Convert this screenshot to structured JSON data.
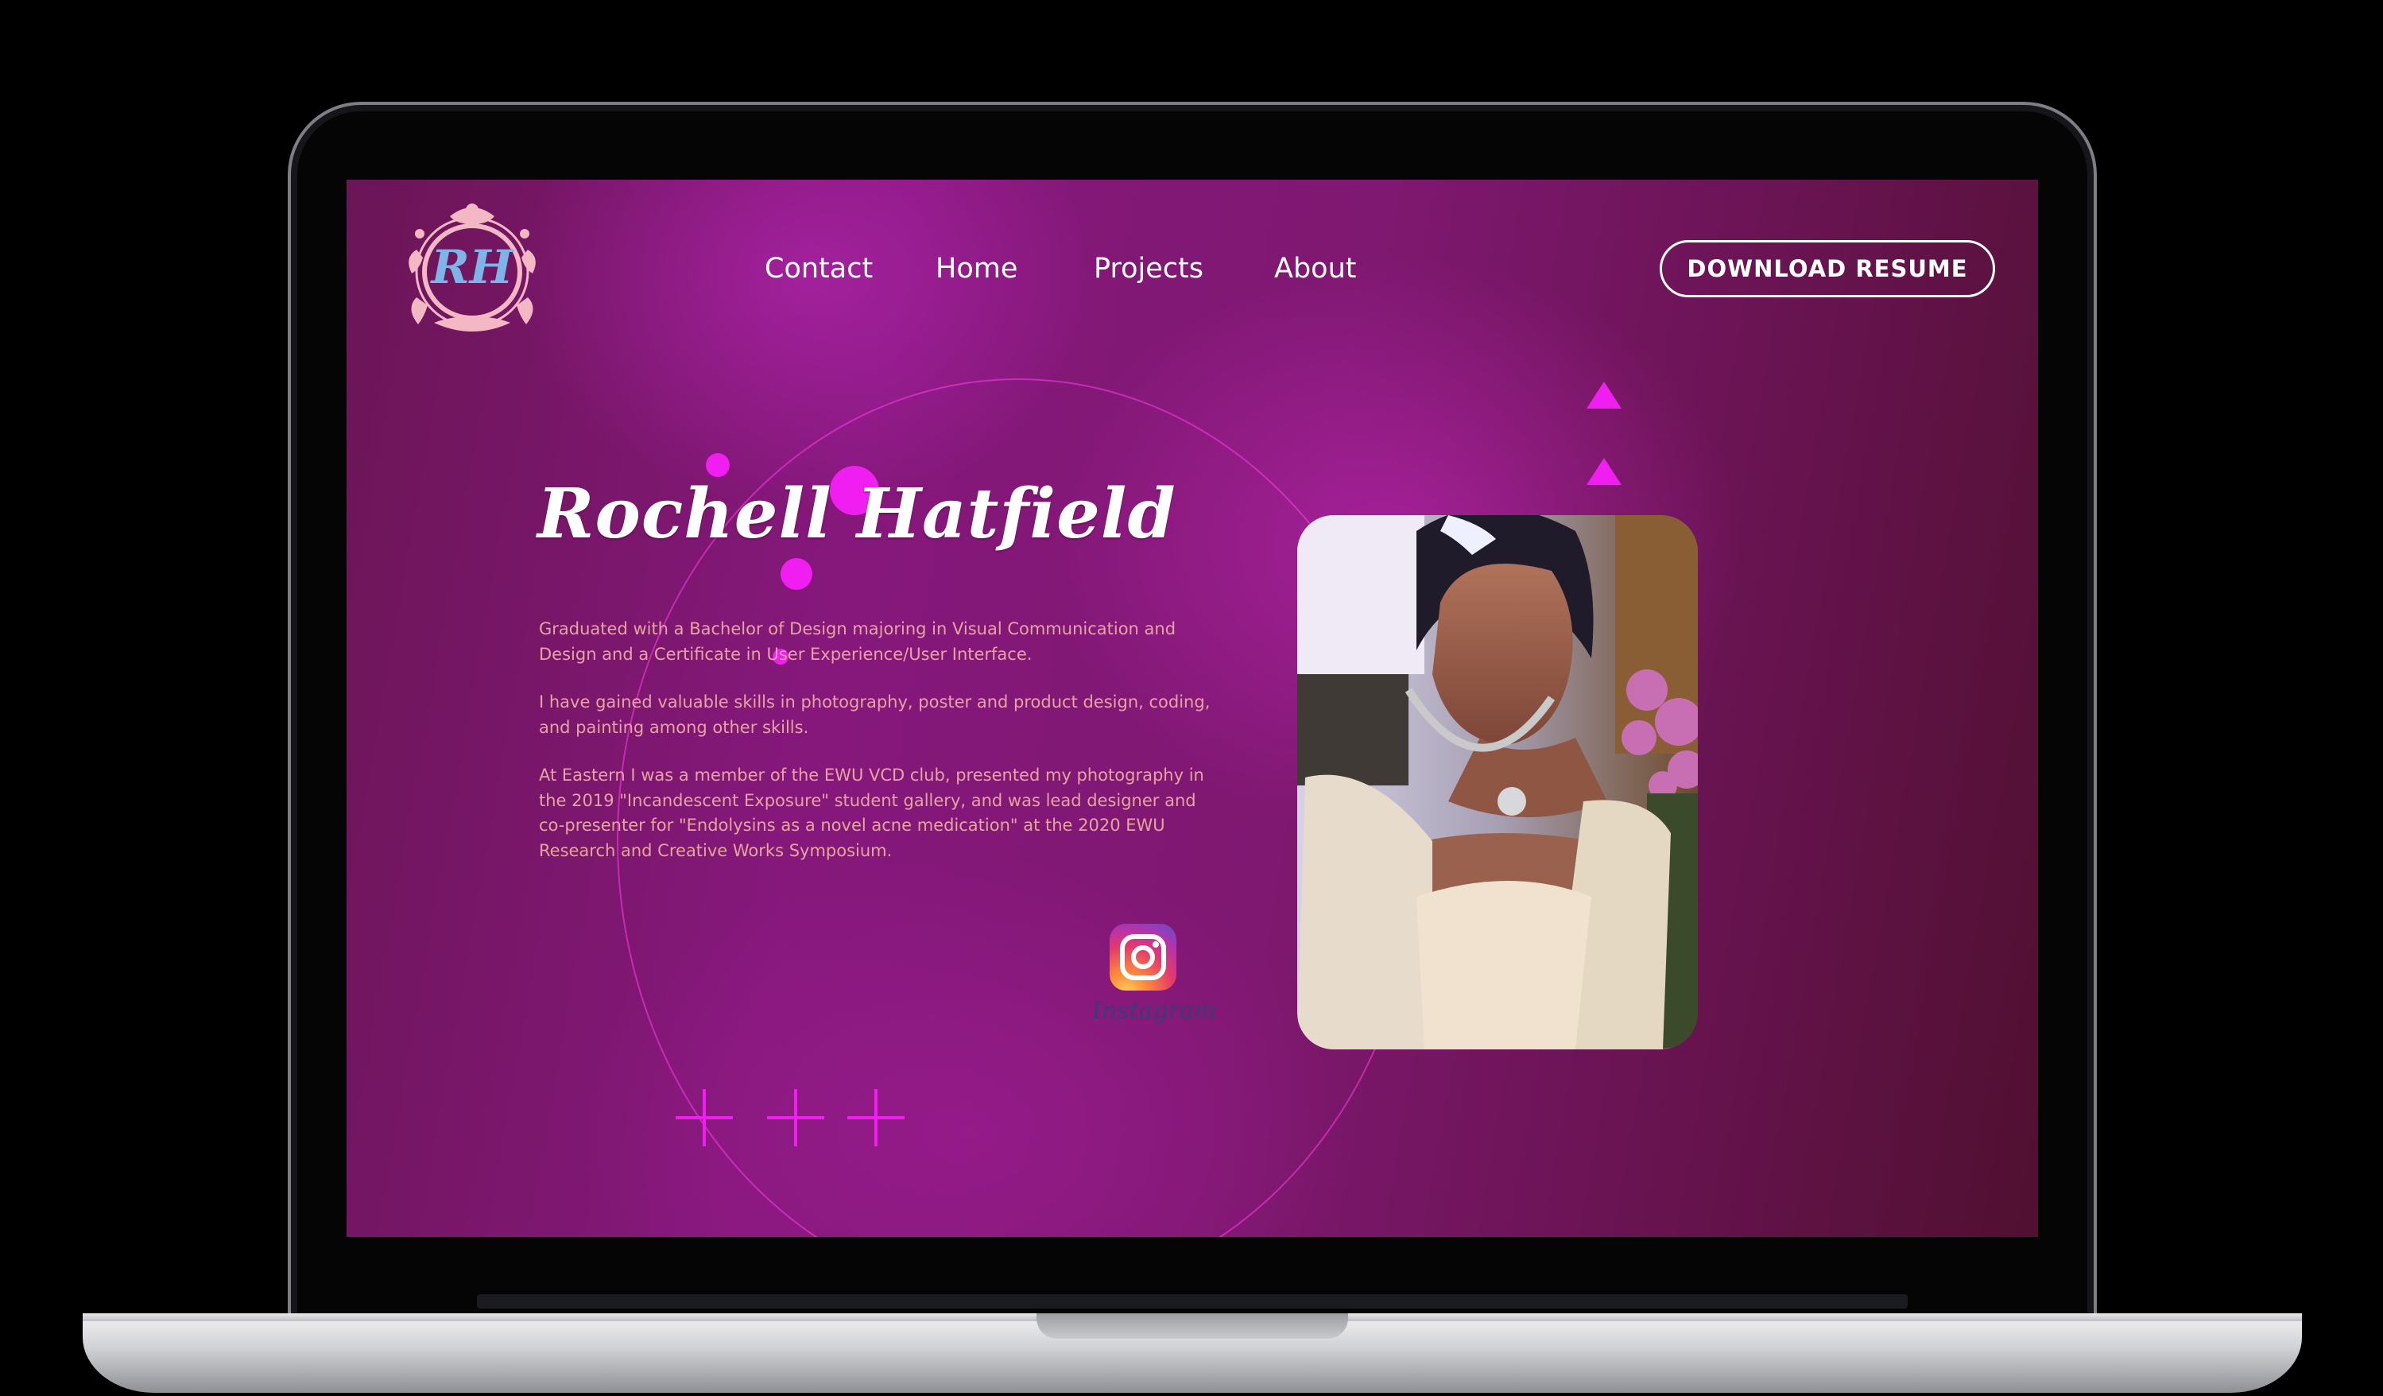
{
  "header": {
    "logo_text": "RH",
    "nav": [
      {
        "label": "Contact"
      },
      {
        "label": "Home"
      },
      {
        "label": "Projects"
      },
      {
        "label": "About"
      }
    ],
    "resume_button": "DOWNLOAD RESUME"
  },
  "hero": {
    "name": "Rochell Hatfield",
    "paragraphs": [
      "Graduated with a Bachelor of Design majoring in Visual Communication and Design and a Certificate in User Experience/User Interface.",
      "I have gained valuable skills in photography, poster and product design, coding, and painting among other skills.",
      "At Eastern I was a member of the EWU VCD club, presented my photography in the 2019 \"Incandescent Exposure\" student gallery, and was lead designer and co-presenter for \"Endolysins as a novel acne medication\" at the 2020 EWU Research and Creative Works Symposium."
    ],
    "social": {
      "label": "Instagram",
      "icon": "instagram-icon"
    }
  },
  "colors": {
    "accent": "#f01ef0",
    "body_text": "#e6a4a0",
    "background": "#7f1871"
  }
}
